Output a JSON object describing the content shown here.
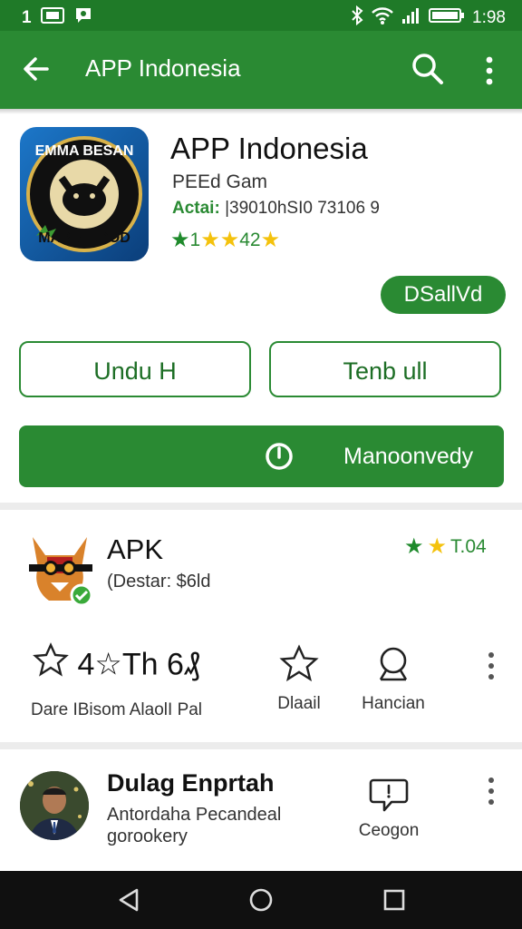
{
  "status_bar": {
    "left_text": "1",
    "time": "1:98"
  },
  "app_bar": {
    "title": "APP Indonesia"
  },
  "app": {
    "title": "APP Indonesia",
    "developer": "PEEd Gam",
    "details_label": "Actai:",
    "details_value": "|39010hSI0 73106 9",
    "rating_text": "42",
    "icon_text_top": "EMMA BESAN",
    "icon_text_bottom": "MAPI ALOOD",
    "badge_label": "DSallVd"
  },
  "buttons": {
    "download_label": "Undu H",
    "share_label": "Tenb ull",
    "main_action_label": "Manoonvedy"
  },
  "apk": {
    "title": "APK",
    "subtitle": "(Destar:  $6ld",
    "rating_value": "T.04"
  },
  "actions": {
    "big_text": "4☆Th 6₰",
    "item1_label": "Dare IBisom  AlaolI Pal",
    "item2_label": "Dlaail",
    "item3_label": "Hancian"
  },
  "profile": {
    "title": "Dulag Enprtah",
    "subtitle_line1": "Antordaha Pecandeal",
    "subtitle_line2": "gorookery",
    "action_label": "Ceogon"
  },
  "colors": {
    "primary": "#2a8a33",
    "status": "#1f7a28",
    "star_yellow": "#f4c20d"
  }
}
